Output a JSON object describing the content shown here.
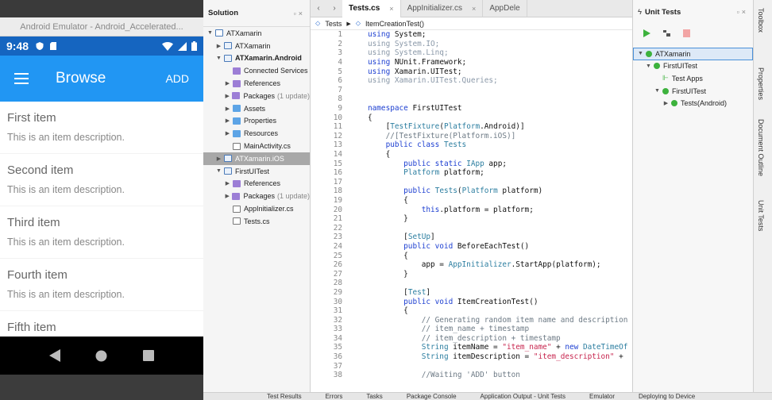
{
  "emulator": {
    "window_title": "Android Emulator - Android_Accelerated...",
    "time": "9:48",
    "app_title": "Browse",
    "add_label": "ADD",
    "items": [
      {
        "title": "First item",
        "desc": "This is an item description."
      },
      {
        "title": "Second item",
        "desc": "This is an item description."
      },
      {
        "title": "Third item",
        "desc": "This is an item description."
      },
      {
        "title": "Fourth item",
        "desc": "This is an item description."
      },
      {
        "title": "Fifth item",
        "desc": ""
      }
    ],
    "brand_color": "#2196f3"
  },
  "solution": {
    "title": "Solution",
    "tree": [
      {
        "label": "ATXamarin",
        "sub": "",
        "arrow": "▼",
        "indent": 0,
        "icon": "sln",
        "bold": false,
        "selected": false
      },
      {
        "label": "ATXamarin",
        "sub": "",
        "arrow": "▶",
        "indent": 1,
        "icon": "proj",
        "bold": false,
        "selected": false
      },
      {
        "label": "ATXamarin.Android",
        "sub": "",
        "arrow": "▼",
        "indent": 1,
        "icon": "proj",
        "bold": true,
        "selected": false
      },
      {
        "label": "Connected Services",
        "sub": "",
        "arrow": "",
        "indent": 2,
        "icon": "pfolder",
        "bold": false,
        "selected": false
      },
      {
        "label": "References",
        "sub": "",
        "arrow": "▶",
        "indent": 2,
        "icon": "pfolder",
        "bold": false,
        "selected": false
      },
      {
        "label": "Packages",
        "sub": "(1 update)",
        "arrow": "▶",
        "indent": 2,
        "icon": "pfolder",
        "bold": false,
        "selected": false
      },
      {
        "label": "Assets",
        "sub": "",
        "arrow": "▶",
        "indent": 2,
        "icon": "folder",
        "bold": false,
        "selected": false
      },
      {
        "label": "Properties",
        "sub": "",
        "arrow": "▶",
        "indent": 2,
        "icon": "folder",
        "bold": false,
        "selected": false
      },
      {
        "label": "Resources",
        "sub": "",
        "arrow": "▶",
        "indent": 2,
        "icon": "folder",
        "bold": false,
        "selected": false
      },
      {
        "label": "MainActivity.cs",
        "sub": "",
        "arrow": "",
        "indent": 2,
        "icon": "file",
        "bold": false,
        "selected": false
      },
      {
        "label": "ATXamarin.iOS",
        "sub": "",
        "arrow": "▶",
        "indent": 1,
        "icon": "proj",
        "bold": false,
        "selected": true
      },
      {
        "label": "FirstUITest",
        "sub": "",
        "arrow": "▼",
        "indent": 1,
        "icon": "proj",
        "bold": false,
        "selected": false
      },
      {
        "label": "References",
        "sub": "",
        "arrow": "▶",
        "indent": 2,
        "icon": "pfolder",
        "bold": false,
        "selected": false
      },
      {
        "label": "Packages",
        "sub": "(1 update)",
        "arrow": "▶",
        "indent": 2,
        "icon": "pfolder",
        "bold": false,
        "selected": false
      },
      {
        "label": "AppInitializer.cs",
        "sub": "",
        "arrow": "",
        "indent": 2,
        "icon": "file",
        "bold": false,
        "selected": false
      },
      {
        "label": "Tests.cs",
        "sub": "",
        "arrow": "",
        "indent": 2,
        "icon": "file",
        "bold": false,
        "selected": false
      }
    ]
  },
  "editor": {
    "tabs": [
      {
        "label": "Tests.cs",
        "active": true,
        "close": "×"
      },
      {
        "label": "AppInitializer.cs",
        "active": false,
        "close": "×"
      },
      {
        "label": "AppDele",
        "active": false,
        "close": ""
      }
    ],
    "crumb_class": "Tests",
    "crumb_method": "ItemCreationTest()",
    "lines": [
      [
        1,
        "<span class='kw'>using</span> System;"
      ],
      [
        2,
        "<span class='dim'>using System.IO;</span>"
      ],
      [
        3,
        "<span class='dim'>using System.Linq;</span>"
      ],
      [
        4,
        "<span class='kw'>using</span> NUnit.Framework;"
      ],
      [
        5,
        "<span class='kw'>using</span> Xamarin.UITest;"
      ],
      [
        6,
        "<span class='dim'>using Xamarin.UITest.Queries;</span>"
      ],
      [
        7,
        ""
      ],
      [
        8,
        ""
      ],
      [
        9,
        "<span class='kw'>namespace</span> FirstUITest"
      ],
      [
        10,
        "{"
      ],
      [
        11,
        "    [<span class='ty'>TestFixture</span>(<span class='ty'>Platform</span>.Android)]"
      ],
      [
        12,
        "    <span class='cm'>//[TestFixture(Platform.iOS)]</span>"
      ],
      [
        13,
        "    <span class='kw'>public class</span> <span class='ty'>Tests</span>"
      ],
      [
        14,
        "    {"
      ],
      [
        15,
        "        <span class='kw'>public static</span> <span class='ty'>IApp</span> app;"
      ],
      [
        16,
        "        <span class='ty'>Platform</span> platform;"
      ],
      [
        17,
        ""
      ],
      [
        18,
        "        <span class='kw'>public</span> <span class='ty'>Tests</span>(<span class='ty'>Platform</span> platform)"
      ],
      [
        19,
        "        {"
      ],
      [
        20,
        "            <span class='kw'>this</span>.platform = platform;"
      ],
      [
        21,
        "        }"
      ],
      [
        22,
        ""
      ],
      [
        23,
        "        [<span class='ty'>SetUp</span>]"
      ],
      [
        24,
        "        <span class='kw'>public void</span> BeforeEachTest()"
      ],
      [
        25,
        "        {"
      ],
      [
        26,
        "            app = <span class='ty'>AppInitializer</span>.StartApp(platform);"
      ],
      [
        27,
        "        }"
      ],
      [
        28,
        ""
      ],
      [
        29,
        "        [<span class='ty'>Test</span>]"
      ],
      [
        30,
        "        <span class='kw'>public void</span> ItemCreationTest()"
      ],
      [
        31,
        "        {"
      ],
      [
        32,
        "            <span class='cm'>// Generating random item name and description</span>"
      ],
      [
        33,
        "            <span class='cm'>// item_name + timestamp</span>"
      ],
      [
        34,
        "            <span class='cm'>// item_description + timestamp</span>"
      ],
      [
        35,
        "            <span class='ty'>String</span> itemName = <span class='st'>\"item_name\"</span> + <span class='kw'>new</span> <span class='ty'>DateTimeOf</span>"
      ],
      [
        36,
        "            <span class='ty'>String</span> itemDescription = <span class='st'>\"item_description\"</span> +"
      ],
      [
        37,
        ""
      ],
      [
        38,
        "            <span class='cm'>//Waiting 'ADD' button</span>"
      ]
    ]
  },
  "unit_tests": {
    "title": "Unit Tests",
    "tree": [
      {
        "label": "ATXamarin",
        "arrow": "▼",
        "indent": 0,
        "icon": "ok",
        "sel": true
      },
      {
        "label": "FirstUITest",
        "arrow": "▼",
        "indent": 1,
        "icon": "ok",
        "sel": false
      },
      {
        "label": "Test Apps",
        "arrow": "",
        "indent": 2,
        "icon": "apps",
        "sel": false
      },
      {
        "label": "FirstUITest",
        "arrow": "▼",
        "indent": 2,
        "icon": "ok",
        "sel": false
      },
      {
        "label": "Tests(Android)",
        "arrow": "▶",
        "indent": 3,
        "icon": "ok",
        "sel": false
      }
    ]
  },
  "side_tabs": [
    "Toolbox",
    "Properties",
    "Document Outline",
    "Unit Tests"
  ],
  "status_items": [
    "Test Results",
    "Errors",
    "Tasks",
    "Package Console",
    "Application Output - Unit Tests",
    "Emulator",
    "Deploying to Device"
  ]
}
